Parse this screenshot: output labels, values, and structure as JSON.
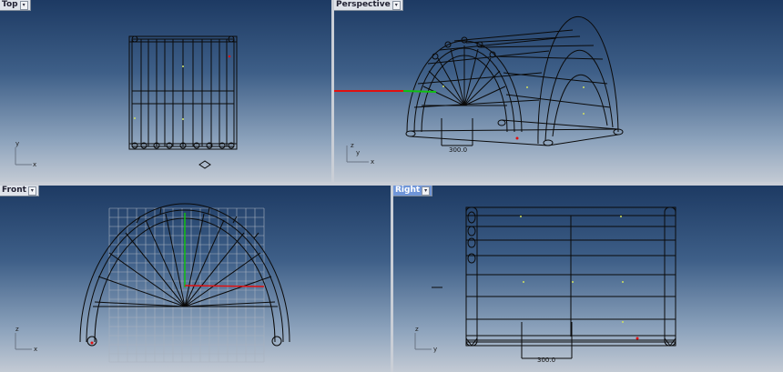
{
  "viewports": {
    "top": {
      "label": "Top",
      "active": false,
      "axis_y": "y",
      "axis_x": "x"
    },
    "perspective": {
      "label": "Perspective",
      "active": false,
      "dimension": "300.0",
      "axis_z": "z",
      "axis_y": "y",
      "axis_x": "x"
    },
    "front": {
      "label": "Front",
      "active": false,
      "axis_z": "z",
      "axis_x": "x"
    },
    "right": {
      "label": "Right",
      "active": true,
      "dimension": "300.0",
      "axis_z": "z",
      "axis_y": "y"
    }
  },
  "dropdown_glyph": "▾",
  "colors": {
    "wire": "#0a0a0a",
    "x_axis": "#e01010",
    "y_axis": "#10c010",
    "grid": "#a9b2bf",
    "active_tab": "#6f95d8"
  }
}
